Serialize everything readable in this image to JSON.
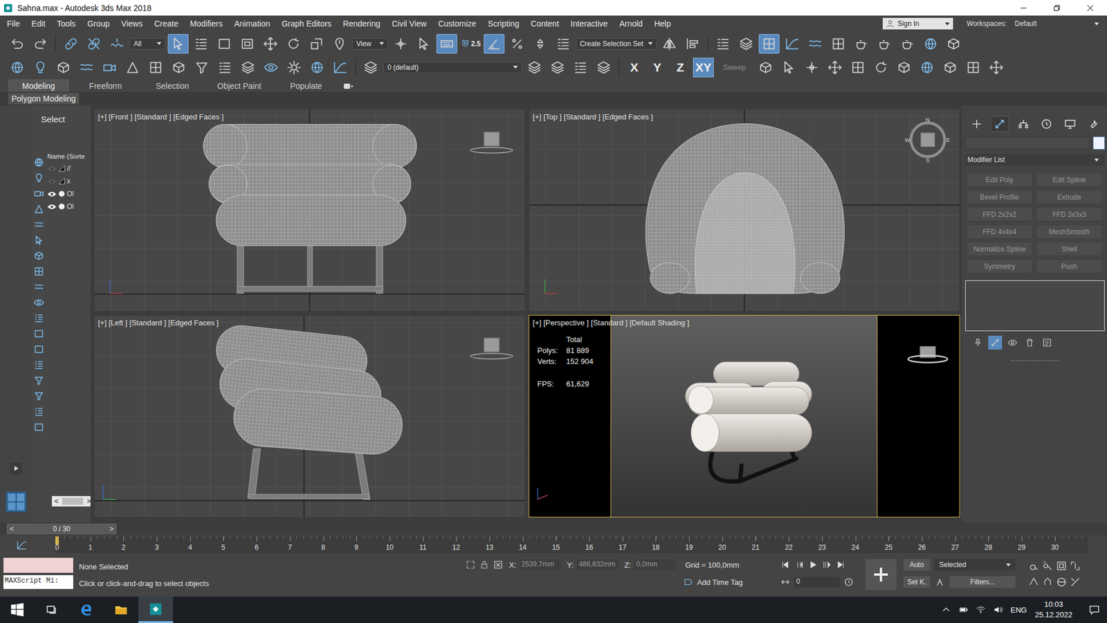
{
  "window": {
    "title": "Sahna.max - Autodesk 3ds Max 2018"
  },
  "menu": [
    "File",
    "Edit",
    "Tools",
    "Group",
    "Views",
    "Create",
    "Modifiers",
    "Animation",
    "Graph Editors",
    "Rendering",
    "Civil View",
    "Customize",
    "Scripting",
    "Content",
    "Interactive",
    "Arnold",
    "Help"
  ],
  "account": {
    "sign_in": "Sign In",
    "workspaces_label": "Workspaces:",
    "workspace": "Default"
  },
  "main_toolbar": [
    {
      "kind": "icon",
      "active": false
    },
    {
      "kind": "icon",
      "active": false
    },
    {
      "kind": "sep"
    },
    {
      "kind": "icon",
      "active": false
    },
    {
      "kind": "icon",
      "active": false
    },
    {
      "kind": "icon",
      "active": false
    },
    {
      "kind": "dropdown",
      "label": "All"
    },
    {
      "kind": "icon",
      "active": true
    },
    {
      "kind": "icon",
      "active": false
    },
    {
      "kind": "icon",
      "active": false
    },
    {
      "kind": "icon",
      "active": false
    },
    {
      "kind": "icon",
      "active": false
    },
    {
      "kind": "icon",
      "active": false
    },
    {
      "kind": "icon",
      "active": false
    },
    {
      "kind": "icon",
      "active": false
    },
    {
      "kind": "dropdown",
      "label": "View"
    },
    {
      "kind": "icon",
      "active": false
    },
    {
      "kind": "icon",
      "active": false
    },
    {
      "kind": "icon",
      "active": true
    },
    {
      "kind": "icon",
      "active": false,
      "label": "2.5"
    },
    {
      "kind": "icon",
      "active": true
    },
    {
      "kind": "icon",
      "active": false
    },
    {
      "kind": "icon",
      "active": false
    },
    {
      "kind": "icon",
      "active": false
    },
    {
      "kind": "dropdown",
      "label": "Create Selection Set"
    },
    {
      "kind": "icon",
      "active": false
    },
    {
      "kind": "icon",
      "active": false
    },
    {
      "kind": "sep"
    },
    {
      "kind": "icon",
      "active": false
    },
    {
      "kind": "icon",
      "active": false
    },
    {
      "kind": "icon",
      "active": true
    },
    {
      "kind": "icon",
      "active": false
    },
    {
      "kind": "icon",
      "active": false
    },
    {
      "kind": "icon",
      "active": false
    },
    {
      "kind": "icon",
      "active": false
    },
    {
      "kind": "icon",
      "active": false
    },
    {
      "kind": "icon",
      "active": false
    },
    {
      "kind": "icon",
      "active": false
    },
    {
      "kind": "icon",
      "active": false
    }
  ],
  "second_toolbar": [
    {
      "kind": "icon",
      "active": false
    },
    {
      "kind": "icon",
      "active": false
    },
    {
      "kind": "icon",
      "active": false
    },
    {
      "kind": "icon",
      "active": false
    },
    {
      "kind": "icon",
      "active": false
    },
    {
      "kind": "icon",
      "active": false
    },
    {
      "kind": "icon",
      "active": false
    },
    {
      "kind": "icon",
      "active": false
    },
    {
      "kind": "icon",
      "active": false
    },
    {
      "kind": "icon",
      "active": false
    },
    {
      "kind": "icon",
      "active": false
    },
    {
      "kind": "icon",
      "active": false
    },
    {
      "kind": "icon",
      "active": false
    },
    {
      "kind": "icon",
      "active": false
    },
    {
      "kind": "icon",
      "active": false
    },
    {
      "kind": "sep"
    },
    {
      "kind": "icon",
      "active": false
    },
    {
      "kind": "dropdown",
      "label": "0 (default)"
    },
    {
      "kind": "icon",
      "active": false
    },
    {
      "kind": "icon",
      "active": false
    },
    {
      "kind": "icon",
      "active": false
    },
    {
      "kind": "icon",
      "active": false
    },
    {
      "kind": "sep"
    },
    {
      "kind": "axis",
      "label": "X",
      "selected": false
    },
    {
      "kind": "axis",
      "label": "Y",
      "selected": false
    },
    {
      "kind": "axis",
      "label": "Z",
      "selected": false
    },
    {
      "kind": "axis",
      "label": "XY",
      "selected": true
    },
    {
      "kind": "text",
      "label": "Sweep",
      "disabled": true
    },
    {
      "kind": "icon",
      "active": false
    },
    {
      "kind": "icon",
      "active": false
    },
    {
      "kind": "icon",
      "active": false
    },
    {
      "kind": "icon",
      "active": false
    },
    {
      "kind": "icon",
      "active": false
    },
    {
      "kind": "icon",
      "active": false
    },
    {
      "kind": "icon",
      "active": false
    },
    {
      "kind": "icon",
      "active": false
    },
    {
      "kind": "icon",
      "active": false
    },
    {
      "kind": "icon",
      "active": false
    },
    {
      "kind": "icon",
      "active": false
    }
  ],
  "ribbon": {
    "tabs": [
      {
        "label": "Modeling",
        "selected": true
      },
      {
        "label": "Freeform",
        "selected": false
      },
      {
        "label": "Selection",
        "selected": false
      },
      {
        "label": "Object Paint",
        "selected": false
      },
      {
        "label": "Populate",
        "selected": false
      }
    ],
    "panel": "Polygon Modeling"
  },
  "scene_explorer": {
    "title": "Select",
    "column": "Name (Sorte",
    "rows": [
      {
        "name": "//",
        "visible": false
      },
      {
        "name": "x",
        "visible": false
      },
      {
        "name": "Ol",
        "visible": true
      },
      {
        "name": "Ol",
        "visible": true
      }
    ],
    "scroll_left": "<",
    "scroll_right": ">"
  },
  "viewports": [
    {
      "label": "[+] [Front ] [Standard ] [Edged Faces ]",
      "kind": "front",
      "active": false
    },
    {
      "label": "[+] [Top ] [Standard ] [Edged Faces ]",
      "kind": "top",
      "active": false
    },
    {
      "label": "[+] [Left ] [Standard ] [Edged Faces ]",
      "kind": "left",
      "active": false
    },
    {
      "label": "[+] [Perspective ] [Standard ] [Default Shading ]",
      "kind": "perspective",
      "active": true
    }
  ],
  "compass": {
    "n": "N",
    "e": "E",
    "s": "S",
    "w": "W"
  },
  "stats": {
    "title": "Total",
    "rows": [
      {
        "label": "Polys:",
        "value": "81 889"
      },
      {
        "label": "Verts:",
        "value": "152 904"
      }
    ],
    "fps_label": "FPS:",
    "fps": "61,629"
  },
  "command_panel": {
    "tabs": [
      {
        "selected": false
      },
      {
        "selected": true
      },
      {
        "selected": false
      },
      {
        "selected": false
      },
      {
        "selected": false
      },
      {
        "selected": false
      }
    ],
    "modifier_list": "Modifier List",
    "buttons": [
      {
        "label": "Edit Poly",
        "disabled": true
      },
      {
        "label": "Edit Spline",
        "disabled": true
      },
      {
        "label": "Bevel Profile",
        "disabled": true
      },
      {
        "label": "Extrude",
        "disabled": true
      },
      {
        "label": "FFD 2x2x2",
        "disabled": true
      },
      {
        "label": "FFD 3x3x3",
        "disabled": true
      },
      {
        "label": "FFD 4x4x4",
        "disabled": true
      },
      {
        "label": "MeshSmooth",
        "disabled": true
      },
      {
        "label": "Normalize Spline",
        "disabled": true
      },
      {
        "label": "Shell",
        "disabled": true
      },
      {
        "label": "Symmetry",
        "disabled": true
      },
      {
        "label": "Push",
        "disabled": true
      }
    ],
    "stack_tools": [
      {
        "active": false
      },
      {
        "active": true
      },
      {
        "active": false
      },
      {
        "active": false
      },
      {
        "active": false
      }
    ]
  },
  "time_slider": {
    "prev": "<",
    "label": "0 / 30",
    "next": ">",
    "level": 0
  },
  "track_bar": {
    "ticks": [
      "0",
      "1",
      "2",
      "3",
      "4",
      "5",
      "6",
      "7",
      "8",
      "9",
      "10",
      "11",
      "12",
      "13",
      "14",
      "15",
      "16",
      "17",
      "18",
      "19",
      "20",
      "21",
      "22",
      "23",
      "24",
      "25",
      "26",
      "27",
      "28",
      "29",
      "30"
    ],
    "current": 0
  },
  "status": {
    "listener": "MAXScript Mi:",
    "selection": "None Selected",
    "prompt": "Click or click-and-drag to select objects",
    "coords": [
      {
        "axis": "X:",
        "value": "2539,7mm"
      },
      {
        "axis": "Y:",
        "value": "486,632mm"
      },
      {
        "axis": "Z:",
        "value": "0,0mm"
      }
    ],
    "grid": "Grid = 100,0mm",
    "time_tag": "Add Time Tag",
    "frame": "0",
    "auto_key": "Auto",
    "key_mode": "Selected",
    "set_key": "Set K.",
    "filters": "Filters..."
  },
  "taskbar": {
    "apps": [
      {
        "selected": false
      },
      {
        "selected": false
      },
      {
        "selected": false
      },
      {
        "selected": true
      }
    ],
    "language": "ENG",
    "time": "10:03",
    "date": "25.12.2022"
  }
}
